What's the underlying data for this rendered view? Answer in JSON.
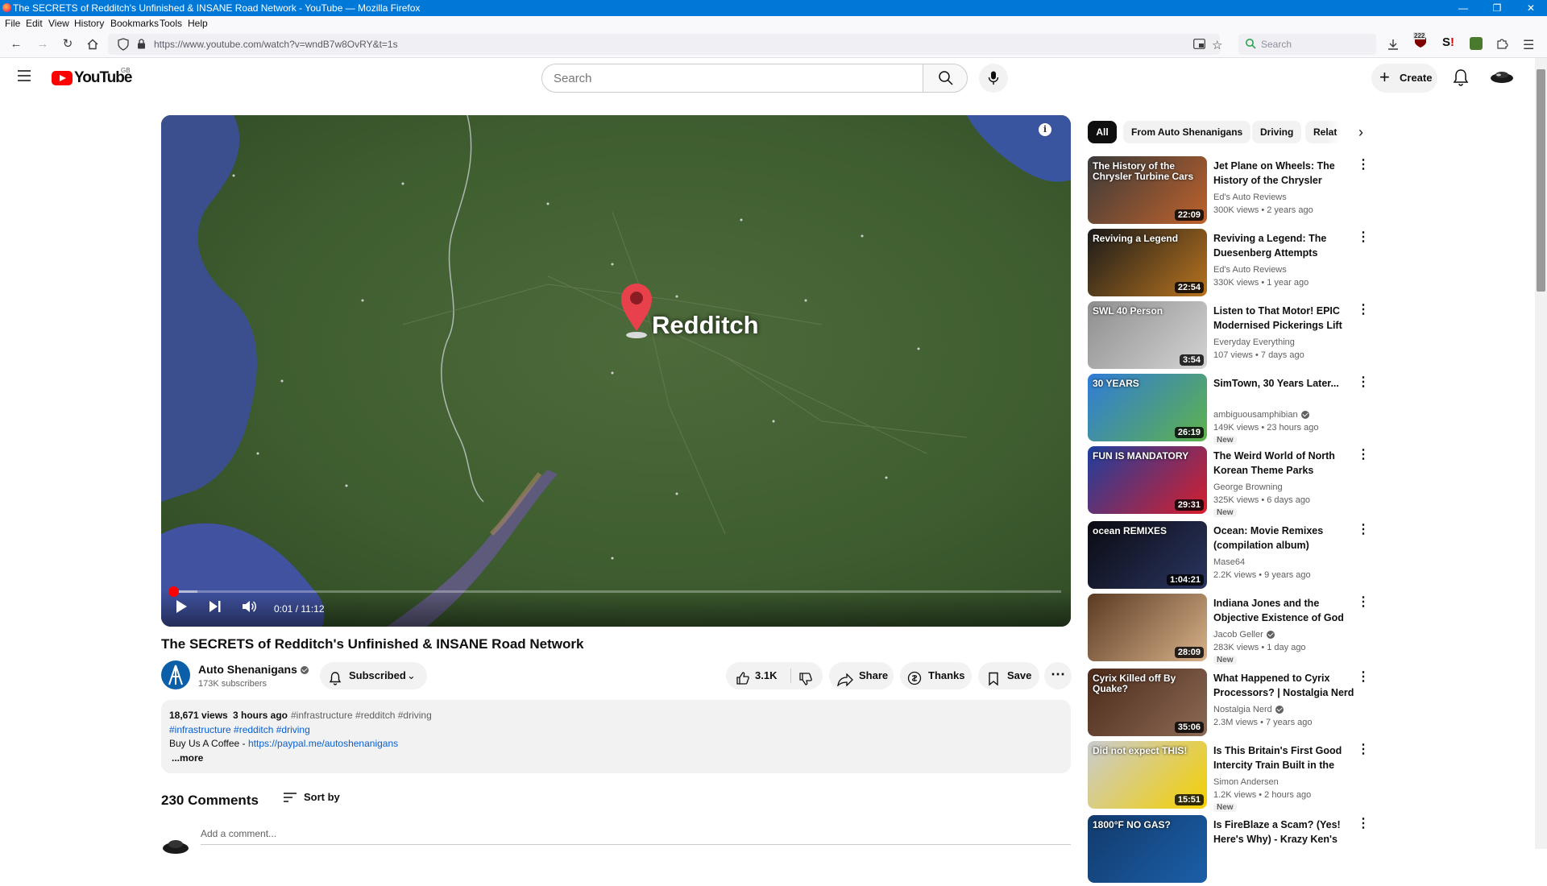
{
  "window": {
    "title": "The SECRETS of Redditch's Unfinished & INSANE Road Network - YouTube — Mozilla Firefox"
  },
  "menubar": [
    "File",
    "Edit",
    "View",
    "History",
    "Bookmarks",
    "Tools",
    "Help"
  ],
  "browser": {
    "url": "https://www.youtube.com/watch?v=wndB7w8OvRY&t=1s",
    "search_placeholder": "Search",
    "extension_badge": "222"
  },
  "yt_header": {
    "logo_text": "YouTube",
    "region": "GB",
    "search_placeholder": "Search",
    "create_label": "Create"
  },
  "player": {
    "overlay_place": "Redditch",
    "current_time": "0:01 / 11:12",
    "progress_fraction": 0.0015,
    "buffered_fraction": 0.03
  },
  "video": {
    "title": "The SECRETS of Redditch's Unfinished & INSANE Road Network",
    "channel": "Auto Shenanigans",
    "subscribers": "173K subscribers",
    "subscribed_label": "Subscribed",
    "likes": "3.1K",
    "share_label": "Share",
    "thanks_label": "Thanks",
    "save_label": "Save"
  },
  "description": {
    "views": "18,671 views",
    "age": "3 hours ago",
    "tags_inline": "#infrastructure #redditch #driving",
    "tags_link": "#infrastructure #redditch #driving",
    "coffee_text": "Buy Us A Coffee - ",
    "coffee_link": "https://paypal.me/autoshenanigans",
    "more": "...more"
  },
  "comments": {
    "count_label": "230 Comments",
    "sort_label": "Sort by",
    "add_placeholder": "Add a comment..."
  },
  "chips": [
    "All",
    "From Auto Shenanigans",
    "Driving",
    "Relat"
  ],
  "recommendations": [
    {
      "title": "Jet Plane on Wheels: The History of the Chrysler Turbine...",
      "channel": "Ed's Auto Reviews",
      "verified": false,
      "views": "300K views",
      "age": "2 years ago",
      "duration": "22:09",
      "badge": "",
      "thumb_text": "The History of the Chrysler Turbine Cars",
      "color1": "#3a3a3a",
      "color2": "#c0622b"
    },
    {
      "title": "Reviving a Legend: The Duesenberg Attempts",
      "channel": "Ed's Auto Reviews",
      "verified": false,
      "views": "330K views",
      "age": "1 year ago",
      "duration": "22:54",
      "badge": "",
      "thumb_text": "Reviving a Legend",
      "color1": "#1a1a1a",
      "color2": "#b8741f"
    },
    {
      "title": "Listen to That Motor! EPIC Modernised Pickerings Lift @...",
      "channel": "Everyday Everything",
      "verified": false,
      "views": "107 views",
      "age": "7 days ago",
      "duration": "3:54",
      "badge": "",
      "thumb_text": "SWL 40 Person",
      "color1": "#8e8e8e",
      "color2": "#d4d4d4"
    },
    {
      "title": "SimTown, 30 Years Later...",
      "channel": "ambiguousamphibian",
      "verified": true,
      "views": "149K views",
      "age": "23 hours ago",
      "duration": "26:19",
      "badge": "New",
      "thumb_text": "30 YEARS",
      "color1": "#2f7bd8",
      "color2": "#5fb34a"
    },
    {
      "title": "The Weird World of North Korean Theme Parks",
      "channel": "George Browning",
      "verified": false,
      "views": "325K views",
      "age": "6 days ago",
      "duration": "29:31",
      "badge": "New",
      "thumb_text": "FUN IS MANDATORY",
      "color1": "#1c3f9e",
      "color2": "#d81e2c"
    },
    {
      "title": "Ocean: Movie Remixes (compilation album)",
      "channel": "Mase64",
      "verified": false,
      "views": "2.2K views",
      "age": "9 years ago",
      "duration": "1:04:21",
      "badge": "",
      "thumb_text": "ocean REMIXES",
      "color1": "#0b0b12",
      "color2": "#2a3560"
    },
    {
      "title": "Indiana Jones and the Objective Existence of God",
      "channel": "Jacob Geller",
      "verified": true,
      "views": "283K views",
      "age": "1 day ago",
      "duration": "28:09",
      "badge": "New",
      "thumb_text": "",
      "color1": "#5a3a22",
      "color2": "#d9b28a"
    },
    {
      "title": "What Happened to Cyrix Processors? | Nostalgia Nerd",
      "channel": "Nostalgia Nerd",
      "verified": true,
      "views": "2.3M views",
      "age": "7 years ago",
      "duration": "35:06",
      "badge": "",
      "thumb_text": "Cyrix Killed off By Quake?",
      "color1": "#4b2a1a",
      "color2": "#8c6a55"
    },
    {
      "title": "Is This Britain's First Good Intercity Train Built in the Last...",
      "channel": "Simon Andersen",
      "verified": false,
      "views": "1.2K views",
      "age": "2 hours ago",
      "duration": "15:51",
      "badge": "New",
      "thumb_text": "Did not expect THIS!",
      "color1": "#c9cbd0",
      "color2": "#f4d000"
    },
    {
      "title": "Is FireBlaze a Scam? (Yes! Here's Why) - Krazy Ken's Tech...",
      "channel": "",
      "verified": false,
      "views": "",
      "age": "",
      "duration": "",
      "badge": "",
      "thumb_text": "1800°F NO GAS?",
      "color1": "#123a6b",
      "color2": "#1b5fa8"
    }
  ],
  "map_labels": [
    "Redditch"
  ]
}
